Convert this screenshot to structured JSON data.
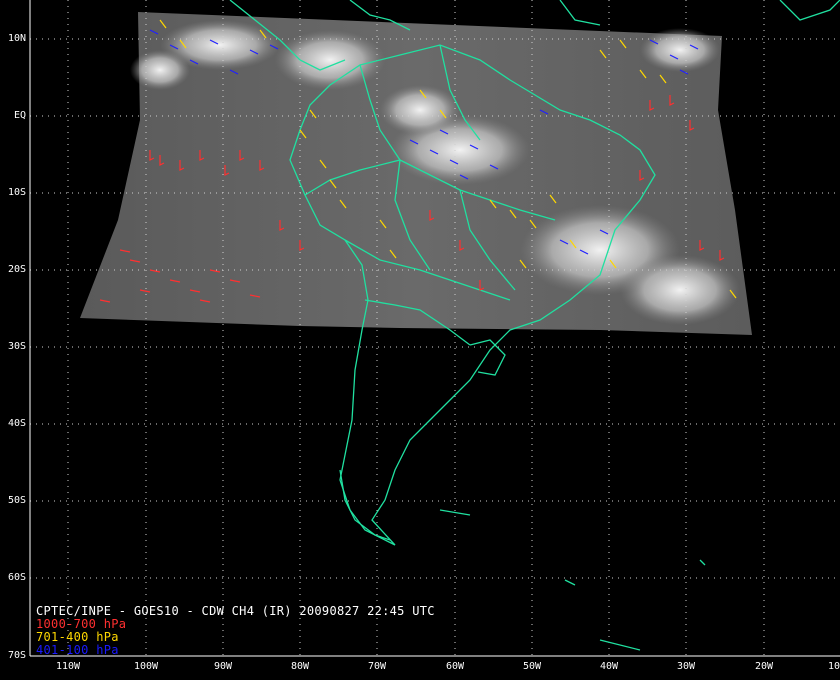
{
  "title": "CPTEC/INPE - GOES10 - CDW CH4 (IR) 20090827 22:45 UTC",
  "legend": [
    {
      "label": "1000-700 hPa",
      "color": "#ff3030"
    },
    {
      "label": "701-400 hPa",
      "color": "#ffd800"
    },
    {
      "label": "401-100 hPa",
      "color": "#1a1aff"
    }
  ],
  "lat_labels": [
    "10N",
    "EQ",
    "10S",
    "20S",
    "30S",
    "40S",
    "50S",
    "60S",
    "70S"
  ],
  "lon_labels": [
    "110W",
    "100W",
    "90W",
    "80W",
    "70W",
    "60W",
    "50W",
    "40W",
    "30W",
    "20W",
    "10"
  ],
  "colors": {
    "coast": "#20e0a0",
    "grid": "#cfcfcf",
    "background": "#000000"
  }
}
